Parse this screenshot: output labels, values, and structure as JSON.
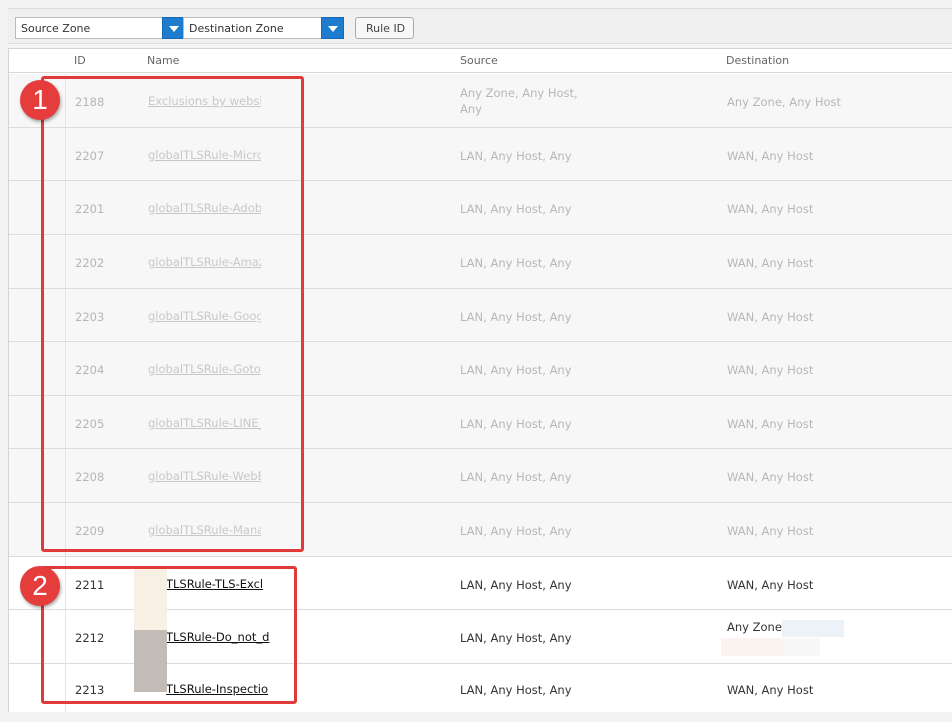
{
  "filters": {
    "source_zone": "Source Zone",
    "destination_zone": "Destination Zone",
    "rule_id": "Rule ID"
  },
  "columns": {
    "id": "ID",
    "name": "Name",
    "source": "Source",
    "destination": "Destination"
  },
  "rows": [
    {
      "id": "2188",
      "name": "Exclusions by website",
      "source": [
        "Any Zone, Any Host,",
        "Any"
      ],
      "destination": "Any Zone, Any Host",
      "state": "disabled"
    },
    {
      "id": "2207",
      "name": "globalTLSRule-Micros",
      "source": [
        "LAN, Any Host, Any"
      ],
      "destination": "WAN, Any Host",
      "state": "disabled"
    },
    {
      "id": "2201",
      "name": "globalTLSRule-Adobe",
      "source": [
        "LAN, Any Host, Any"
      ],
      "destination": "WAN, Any Host",
      "state": "disabled"
    },
    {
      "id": "2202",
      "name": "globalTLSRule-Amazo",
      "source": [
        "LAN, Any Host, Any"
      ],
      "destination": "WAN, Any Host",
      "state": "disabled"
    },
    {
      "id": "2203",
      "name": "globalTLSRule-Google",
      "source": [
        "LAN, Any Host, Any"
      ],
      "destination": "WAN, Any Host",
      "state": "disabled"
    },
    {
      "id": "2204",
      "name": "globalTLSRule-GotoM",
      "source": [
        "LAN, Any Host, Any"
      ],
      "destination": "WAN, Any Host",
      "state": "disabled"
    },
    {
      "id": "2205",
      "name": "globalTLSRule-LINE_",
      "source": [
        "LAN, Any Host, Any"
      ],
      "destination": "WAN, Any Host",
      "state": "disabled"
    },
    {
      "id": "2208",
      "name": "globalTLSRule-WebEX",
      "source": [
        "LAN, Any Host, Any"
      ],
      "destination": "WAN, Any Host",
      "state": "disabled"
    },
    {
      "id": "2209",
      "name": "globalTLSRule-Manag",
      "source": [
        "LAN, Any Host, Any"
      ],
      "destination": "WAN, Any Host",
      "state": "disabled"
    },
    {
      "id": "2211",
      "name": "TLSRule-TLS-Excl",
      "source": [
        "LAN, Any Host, Any"
      ],
      "destination": "WAN, Any Host",
      "state": "enabled"
    },
    {
      "id": "2212",
      "name": "TLSRule-Do_not_d",
      "source": [
        "LAN, Any Host, Any"
      ],
      "destination": "Any Zone,",
      "state": "enabled"
    },
    {
      "id": "2213",
      "name": "TLSRule-Inspectio",
      "source": [
        "LAN, Any Host, Any"
      ],
      "destination": "WAN, Any Host",
      "state": "enabled"
    }
  ],
  "annotations": {
    "callout_1": "1",
    "callout_2": "2"
  },
  "colors": {
    "accent": "#1d7ccd",
    "callout": "#e03a3a"
  }
}
